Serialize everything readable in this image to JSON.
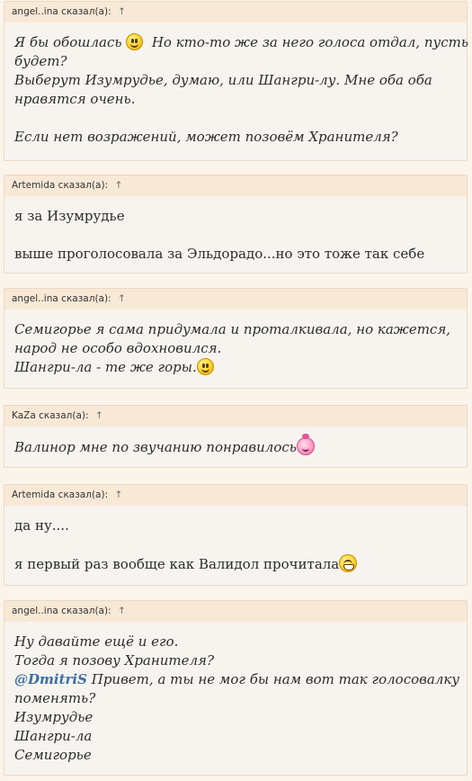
{
  "posts": [
    {
      "author": "angel..ina",
      "said": "сказал(а):",
      "arrow": "↑",
      "lines": [
        "Я бы обошлась",
        "Но кто-то же за него голоса отдал, пусть",
        "будет?",
        "Выберут Изумрудье, думаю, или Шангри-лу. Мне оба оба",
        "нравятся очень.",
        "Если нет возражений, может позовём Хранителя?"
      ]
    },
    {
      "author": "Artemida",
      "said": "сказал(а):",
      "arrow": "↑",
      "lines": [
        "я за Изумрудье",
        "выше проголосовала за Эльдорадо...но это тоже так себе"
      ]
    },
    {
      "author": "angel..ina",
      "said": "сказал(а):",
      "arrow": "↑",
      "lines": [
        "Семигорье я сама придумала и проталкивала, но кажется,",
        "народ не особо вдохновился.",
        "Шангри-ла - те же горы."
      ]
    },
    {
      "author": "KaZa",
      "said": "сказал(а):",
      "arrow": "↑",
      "lines": [
        "Валинор мне по звучанию понравилось"
      ]
    },
    {
      "author": "Artemida",
      "said": "сказал(а):",
      "arrow": "↑",
      "lines": [
        "да ну....",
        "я первый раз вообще как Валидол прочитала"
      ]
    },
    {
      "author": "angel..ina",
      "said": "сказал(а):",
      "arrow": "↑",
      "lines": [
        "Ну давайте ещё и его.",
        "Тогда я позову Хранителя?",
        "@DmitriS",
        "Привет, а ты не мог бы нам вот так голосовалку",
        "поменять?",
        "Изумрудье",
        "Шангри-ла",
        "Семигорье"
      ]
    }
  ]
}
